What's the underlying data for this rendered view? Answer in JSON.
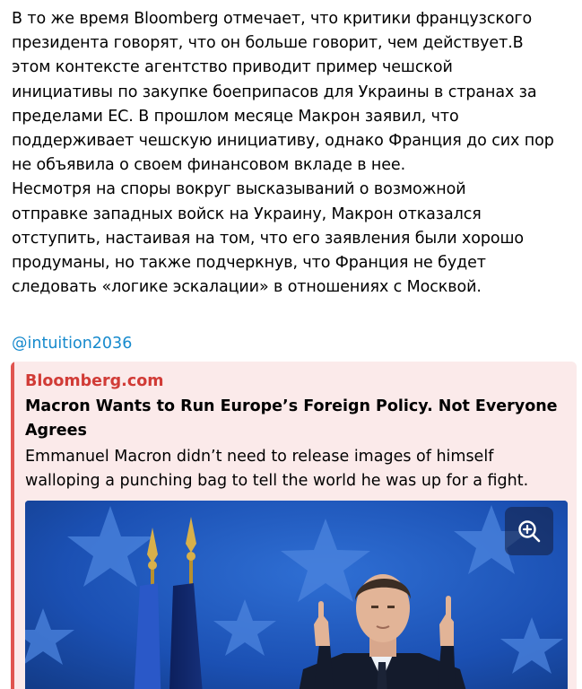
{
  "post": {
    "body_lines": [
      "В то же время Bloomberg отмечает, что критики французского",
      "президента говорят, что он больше говорит, чем действует.В",
      "этом контексте агентство приводит пример чешской",
      "инициативы по закупке боеприпасов для Украины в странах за",
      "пределами ЕС. В прошлом месяце Макрон заявил, что",
      "поддерживает чешскую инициативу, однако Франция до сих пор",
      "не объявила о своем финансовом вкладе в нее.",
      "Несмотря на споры вокруг высказываний о возможной",
      "отправке западных войск на Украину, Макрон отказался",
      "отступить, настаивая на том, что его заявления были хорошо",
      "продуманы, но также подчеркнув, что Франция не будет",
      "следовать «логике эскалации» в отношениях с Москвой."
    ],
    "mention": "@intuition2036"
  },
  "link_preview": {
    "site_name": "Bloomberg.com",
    "title_lines": [
      "Macron Wants to Run Europe’s Foreign Policy. Not Everyone",
      "Agrees"
    ],
    "description_lines": [
      "Emmanuel Macron didn’t need to release images of himself",
      "walloping a punching bag to tell the world he was up for a fight."
    ],
    "zoom_icon": "zoom-in-icon"
  },
  "colors": {
    "link": "#168acd",
    "preview_accent": "#e05550",
    "preview_site": "#d13b36",
    "preview_background": "#fbeaea",
    "photo_blue": "#1a4fb0"
  }
}
